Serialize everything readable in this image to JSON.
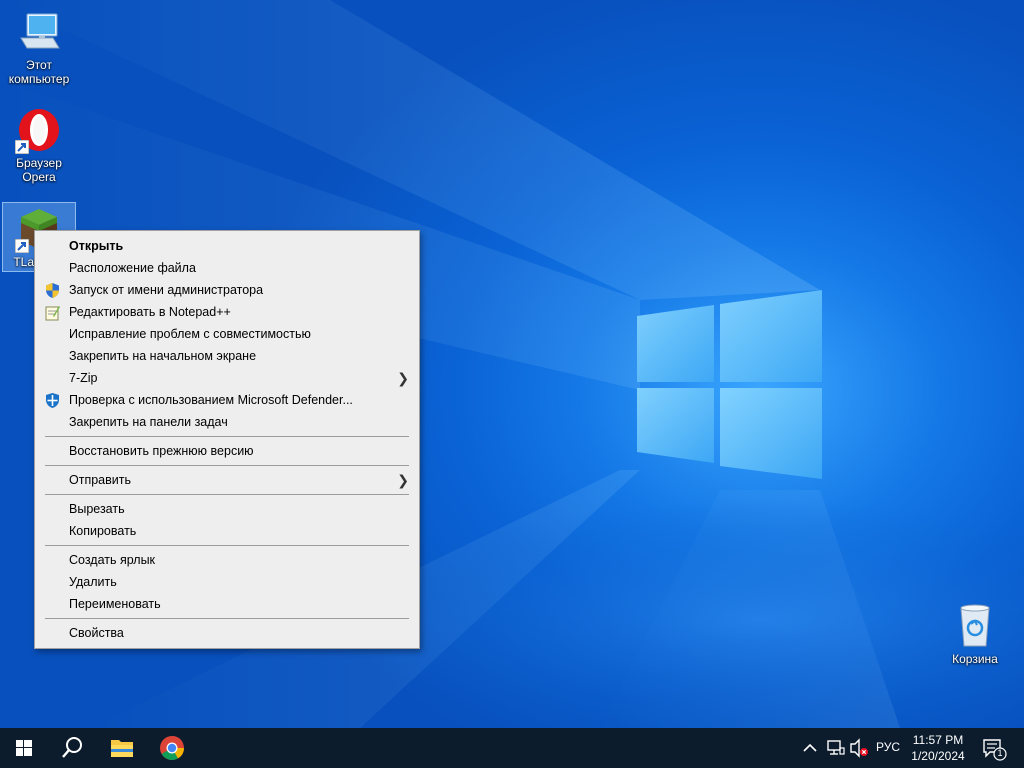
{
  "desktop": {
    "icons": [
      {
        "label": "Этот компьютер"
      },
      {
        "label": "Браузер Opera"
      },
      {
        "label": "TLau"
      },
      {
        "label": "Корзина"
      }
    ]
  },
  "context_menu": {
    "items": [
      {
        "label": "Открыть"
      },
      {
        "label": "Расположение файла"
      },
      {
        "label": "Запуск от имени администратора",
        "icon": "uac-shield-icon"
      },
      {
        "label": "Редактировать в Notepad++",
        "icon": "notepadpp-icon"
      },
      {
        "label": "Исправление проблем с совместимостью"
      },
      {
        "label": "Закрепить на начальном экране"
      },
      {
        "label": "7-Zip",
        "submenu": true
      },
      {
        "label": "Проверка с использованием Microsoft Defender...",
        "icon": "defender-icon"
      },
      {
        "label": "Закрепить на панели задач"
      },
      {
        "label": "Восстановить прежнюю версию"
      },
      {
        "label": "Отправить",
        "submenu": true
      },
      {
        "label": "Вырезать"
      },
      {
        "label": "Копировать"
      },
      {
        "label": "Создать ярлык"
      },
      {
        "label": "Удалить"
      },
      {
        "label": "Переименовать"
      },
      {
        "label": "Свойства"
      }
    ]
  },
  "taskbar": {
    "apps": [
      "start-icon",
      "search-icon",
      "file-explorer-icon",
      "chrome-icon"
    ],
    "tray": {
      "language": "РУС",
      "time": "11:57 PM",
      "date": "1/20/2024",
      "notification_count": "1"
    }
  },
  "colors": {
    "taskbar": "#0c1c2c",
    "menu_background": "#eeeeee",
    "wallpaper_blue": "#0a62d4"
  }
}
